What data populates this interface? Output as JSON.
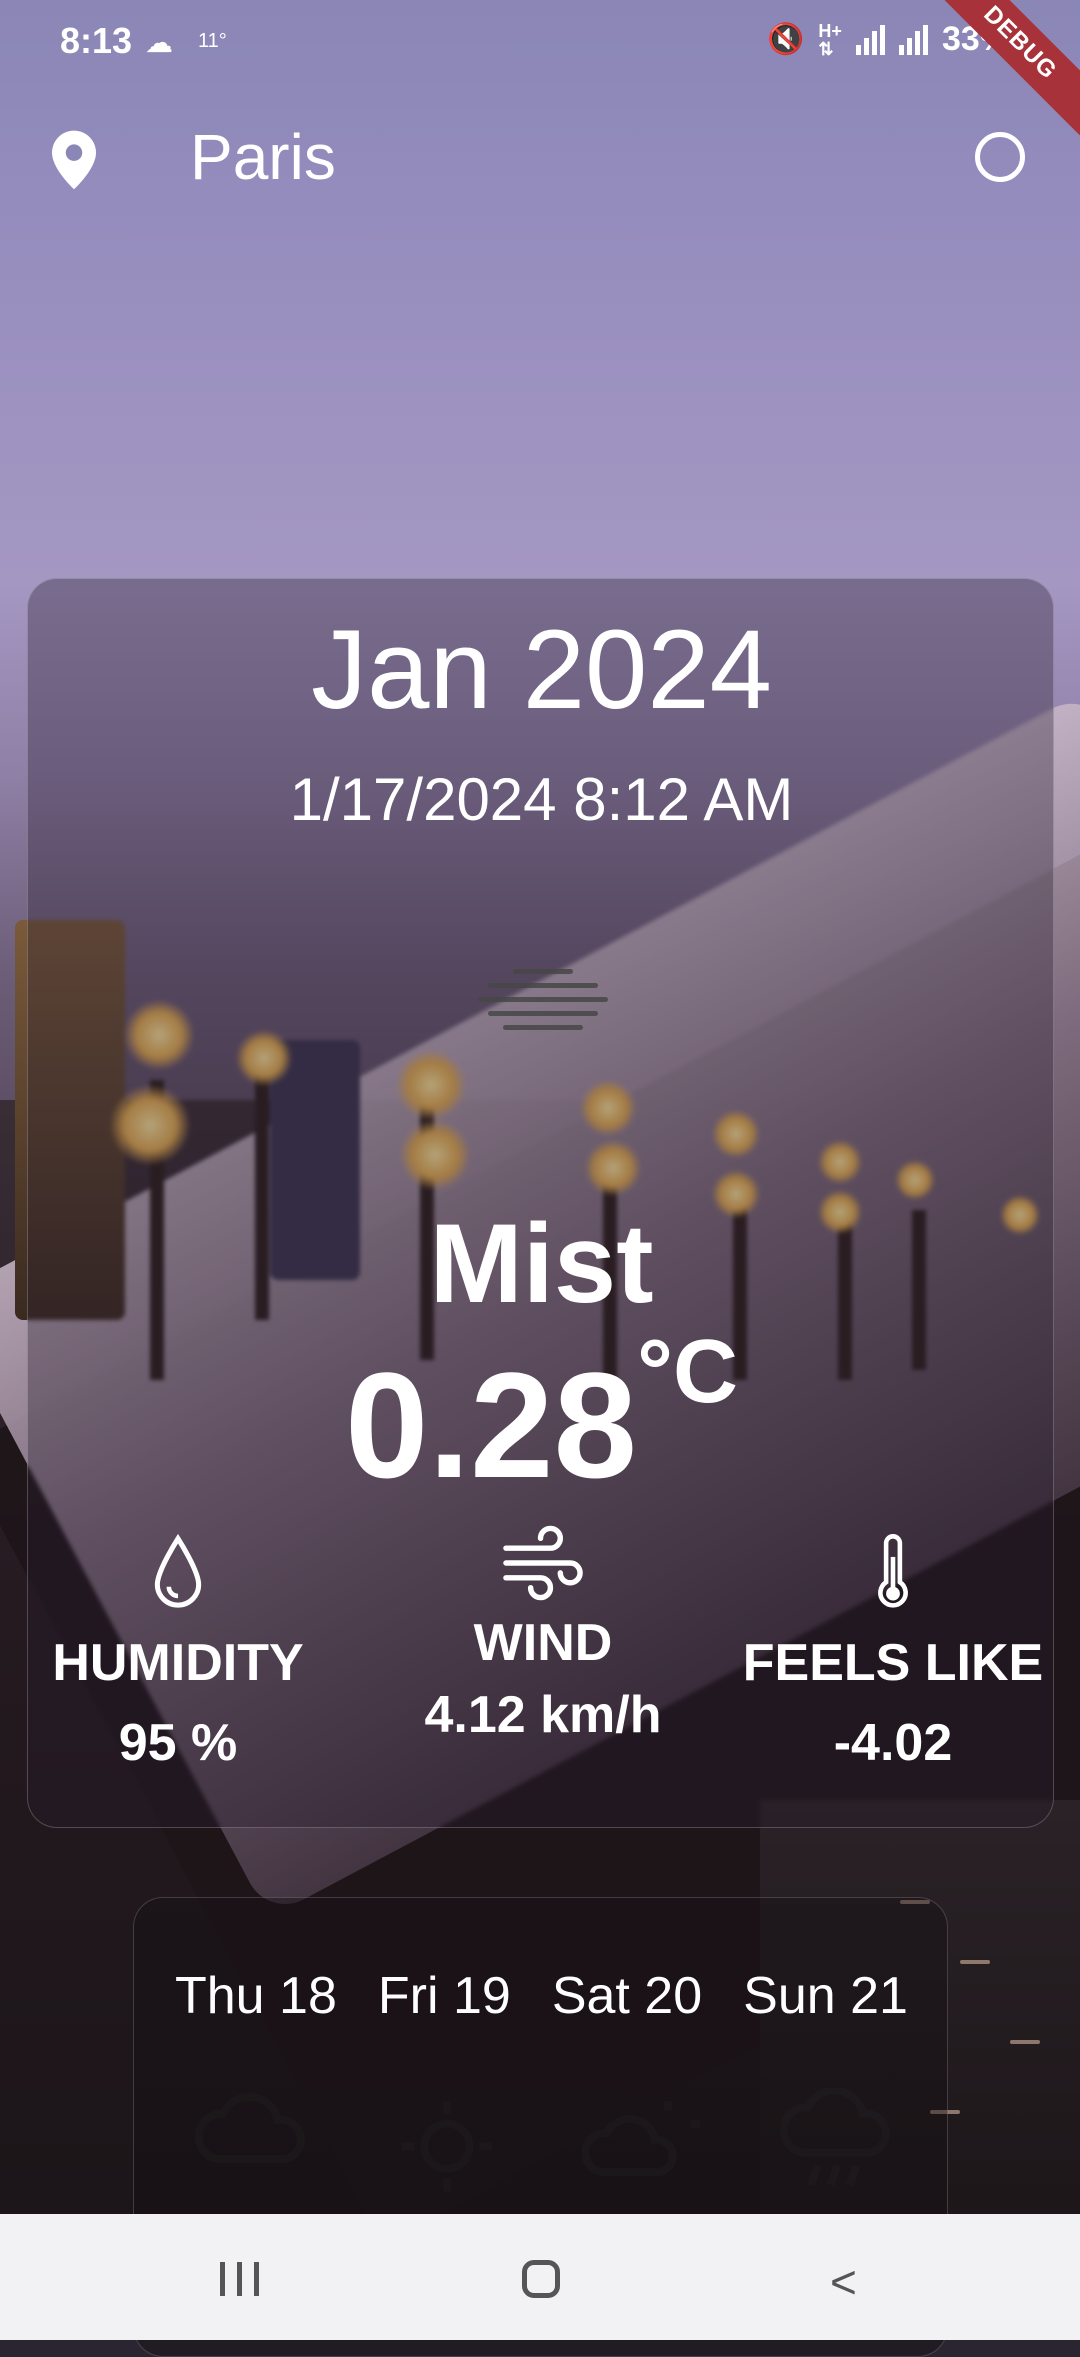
{
  "status_bar": {
    "time": "8:13",
    "weather_icon": "cloud-icon",
    "temp": "11°",
    "battery": "33%",
    "debug_label": "DEBUG"
  },
  "header": {
    "city": "Paris",
    "location_icon": "map-pin-icon",
    "refresh_icon": "circle-icon"
  },
  "weather": {
    "month": "Jan 2024",
    "datetime": "1/17/2024 8:12 AM",
    "condition_icon": "mist-icon",
    "condition": "Mist",
    "temperature": "0.28",
    "unit": "°C",
    "stats": [
      {
        "icon": "droplet-icon",
        "label": "HUMIDITY",
        "value": "95 %"
      },
      {
        "icon": "wind-icon",
        "label": "WIND",
        "value": "4.12 km/h"
      },
      {
        "icon": "thermometer-icon",
        "label": "FEELS LIKE",
        "value": "-4.02"
      }
    ]
  },
  "forecast": {
    "days": [
      "Thu 18",
      "Fri 19",
      "Sat 20",
      "Sun 21"
    ],
    "icons": [
      "cloud-rain-icon",
      "sun-icon",
      "partly-cloudy-icon",
      "rain-icon"
    ]
  },
  "nav": {
    "recent_icon": "recent-apps-icon",
    "home_icon": "home-icon",
    "back_icon": "back-icon"
  }
}
